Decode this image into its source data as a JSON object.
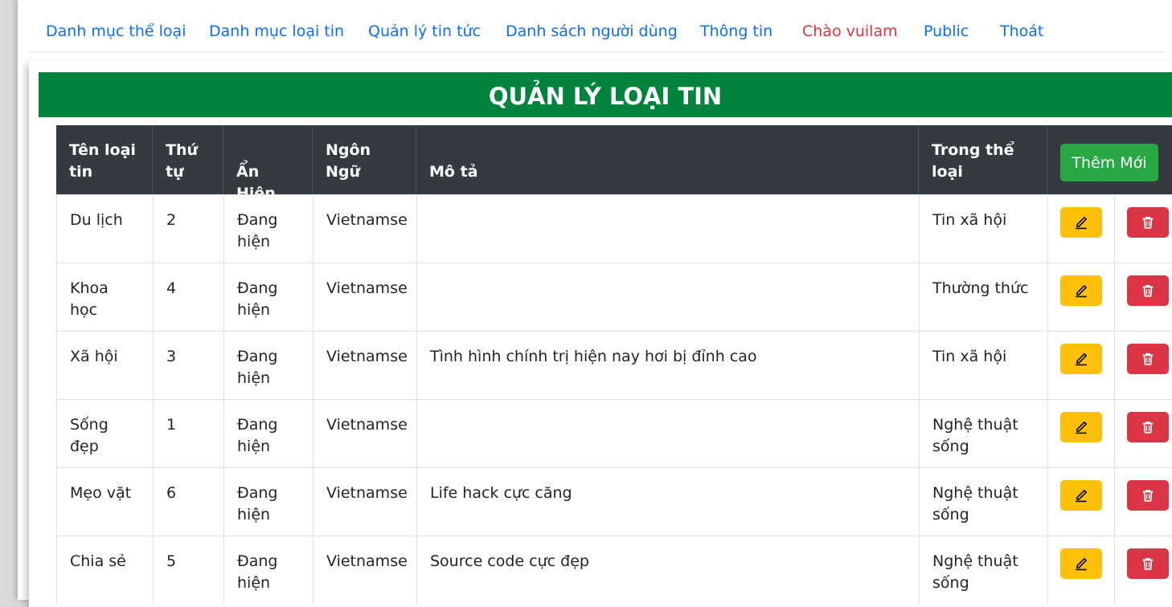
{
  "nav": {
    "items": [
      "Danh mục thể loại",
      "Danh mục loại tin",
      "Quản lý tin tức",
      "Danh sách người dùng",
      "Thông tin"
    ],
    "greeting": "Chào vuilam",
    "public": "Public",
    "logout": "Thoát"
  },
  "page_title": "QUẢN LÝ LOẠI TIN",
  "table": {
    "headers": {
      "name": "Tên loại tin",
      "order": "Thứ tự",
      "visibility": "Ẩn Hiện",
      "language": "Ngôn Ngữ",
      "description": "Mô tả",
      "category": "Trong thể loại"
    },
    "add_button": "Thêm Mới",
    "rows": [
      {
        "name": "Du lịch",
        "order": "2",
        "visibility": "Đang hiện",
        "language": "Vietnamse",
        "description": "",
        "category": "Tin xã hội"
      },
      {
        "name": "Khoa học",
        "order": "4",
        "visibility": "Đang hiện",
        "language": "Vietnamse",
        "description": "",
        "category": "Thường thức"
      },
      {
        "name": "Xã hội",
        "order": "3",
        "visibility": "Đang hiện",
        "language": "Vietnamse",
        "description": "Tình hình chính trị hiện nay hơi bị đỉnh cao",
        "category": "Tin xã hội"
      },
      {
        "name": "Sống đẹp",
        "order": "1",
        "visibility": "Đang hiện",
        "language": "Vietnamse",
        "description": "",
        "category": "Nghệ thuật sống"
      },
      {
        "name": "Mẹo vặt",
        "order": "6",
        "visibility": "Đang hiện",
        "language": "Vietnamse",
        "description": "Life hack cực căng",
        "category": "Nghệ thuật sống"
      },
      {
        "name": "Chia sẻ",
        "order": "5",
        "visibility": "Đang hiện",
        "language": "Vietnamse",
        "description": "Source code cực đẹp",
        "category": "Nghệ thuật sống"
      }
    ]
  },
  "icons": {
    "edit": "pencil-icon",
    "delete": "trash-icon"
  },
  "colors": {
    "title_bg": "#00833c",
    "header_bg": "#343a40",
    "link": "#0d6efd",
    "greeting": "#dc3545",
    "edit": "#ffc107",
    "delete": "#dc3545",
    "add": "#28a745"
  }
}
